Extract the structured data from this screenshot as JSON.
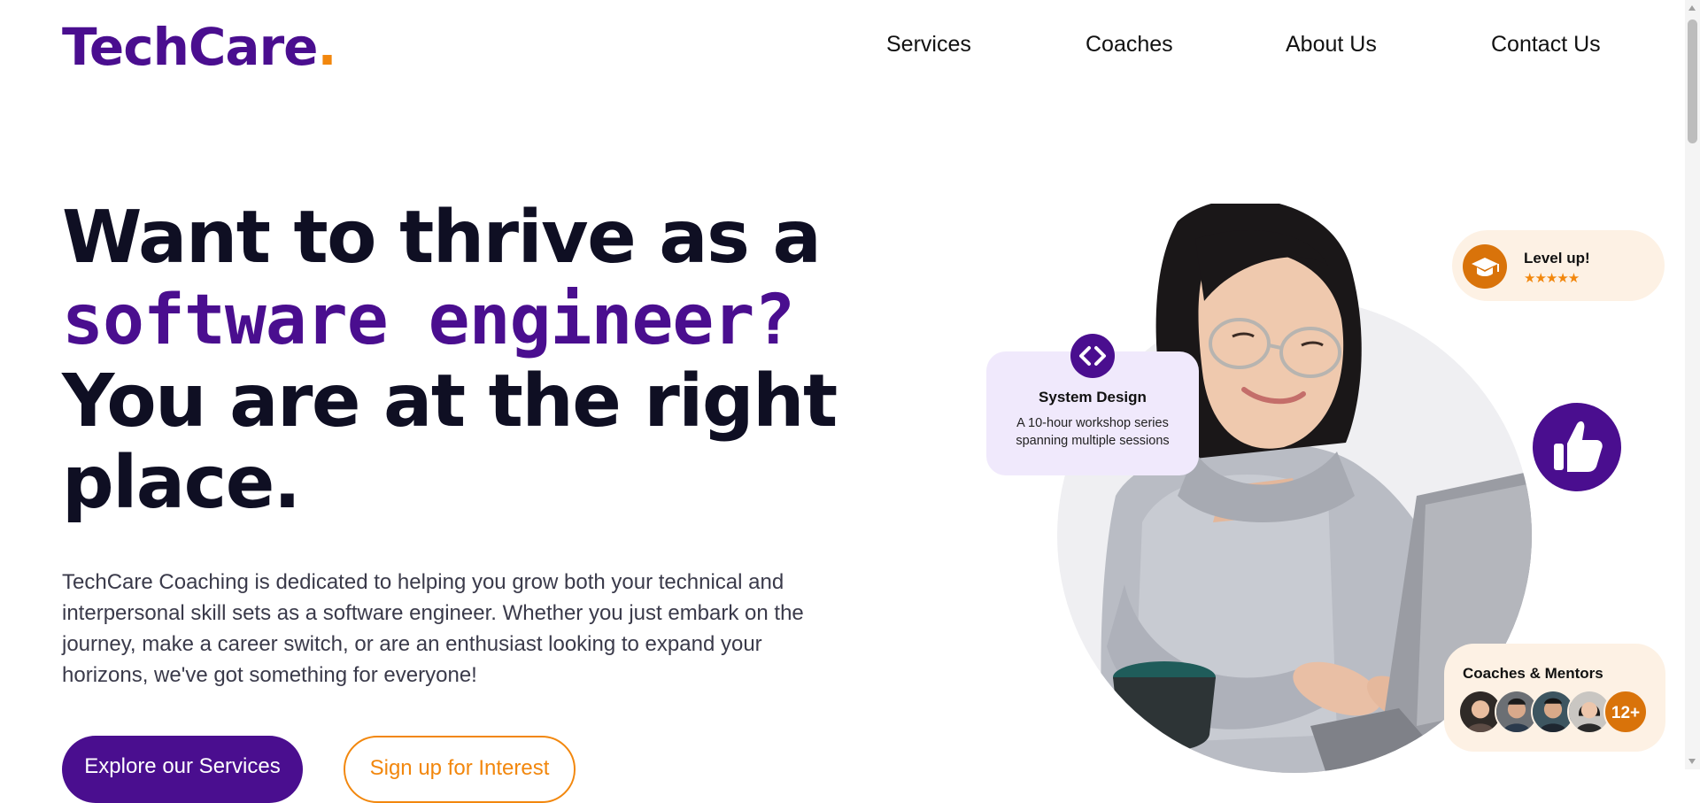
{
  "brand": {
    "name": "TechCare",
    "dot": "."
  },
  "nav": {
    "items": [
      "Services",
      "Coaches",
      "About Us",
      "Contact Us"
    ]
  },
  "hero": {
    "headline_pre": "Want to thrive as a ",
    "headline_highlight": "software engineer?",
    "headline_post": " You are at the right place.",
    "intro": "TechCare Coaching is dedicated to helping you grow both your technical and interpersonal skill sets as a software engineer. Whether you just embark on the journey, make a career switch, or are an enthusiast looking to expand your horizons, we've got something for everyone!",
    "primary_button": "Explore our Services",
    "secondary_button": "Sign up for Interest"
  },
  "cards": {
    "system_design": {
      "icon": "code-brackets-icon",
      "title": "System Design",
      "description": "A 10-hour workshop series spanning multiple sessions"
    },
    "level_up": {
      "icon": "graduation-cap-icon",
      "title": "Level up!",
      "stars": "★★★★★",
      "rating": 5
    },
    "coaches": {
      "title": "Coaches & Mentors",
      "count": "12+"
    }
  },
  "colors": {
    "brand_purple": "#4a0e8f",
    "accent_orange": "#f2870d",
    "card_lavender": "#f0e9fc",
    "card_cream": "#fdf1e4"
  }
}
